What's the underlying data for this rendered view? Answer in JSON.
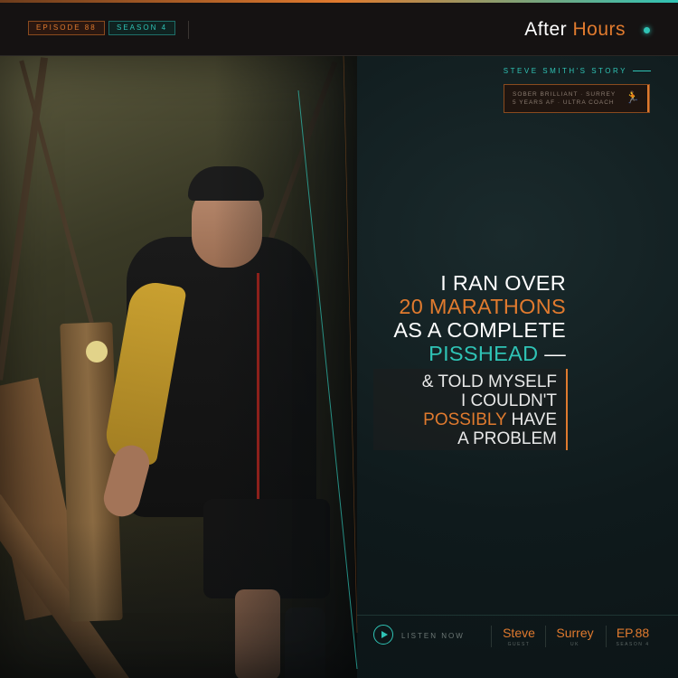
{
  "header": {
    "episode_badge": "EPISODE 88",
    "season_badge": "SEASON 4",
    "brand_main": "After",
    "brand_accent": "Hours"
  },
  "story": {
    "label": "STEVE SMITH'S STORY",
    "info_line1": "SOBER BRILLIANT · SURREY",
    "info_line2": "5 YEARS AF · ULTRA COACH",
    "icon": "runner-icon"
  },
  "headline": {
    "line1": "I RAN OVER",
    "line2": "20 MARATHONS",
    "line3": "AS A COMPLETE",
    "line4_highlight": "PISSHEAD",
    "line4_rest": " —"
  },
  "subhead": {
    "line1": "& TOLD MYSELF",
    "line2": "I COULDN'T",
    "line3_highlight": "POSSIBLY",
    "line3_rest": " HAVE",
    "line4": "A PROBLEM"
  },
  "footer": {
    "listen_label": "LISTEN NOW",
    "guest_value": "Steve",
    "guest_label": "GUEST",
    "location_value": "Surrey",
    "location_label": "UK",
    "episode_value": "EP.88",
    "episode_label": "SEASON 4"
  },
  "colors": {
    "accent_orange": "#e07a2e",
    "accent_teal": "#2fc3b5",
    "background": "#0d1417"
  }
}
